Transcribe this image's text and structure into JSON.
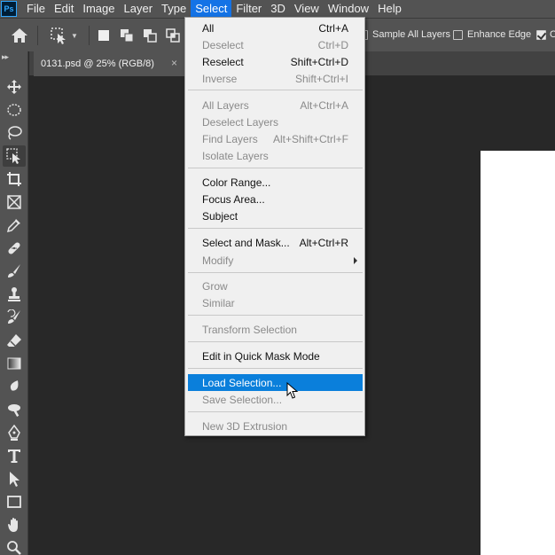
{
  "app": {
    "logo": "Ps"
  },
  "menubar": {
    "items": [
      "File",
      "Edit",
      "Image",
      "Layer",
      "Type",
      "Select",
      "Filter",
      "3D",
      "View",
      "Window",
      "Help"
    ],
    "active": "Select"
  },
  "options": {
    "sample_all_layers": "Sample All Layers",
    "enhance_edge": "Enhance Edge",
    "truncated_label": "O"
  },
  "tab": {
    "title": "0131.psd @ 25% (RGB/8)",
    "close_glyph": "×"
  },
  "select_menu": {
    "items": [
      {
        "label": "All",
        "shortcut": "Ctrl+A",
        "disabled": false
      },
      {
        "label": "Deselect",
        "shortcut": "Ctrl+D",
        "disabled": true
      },
      {
        "label": "Reselect",
        "shortcut": "Shift+Ctrl+D",
        "disabled": false
      },
      {
        "label": "Inverse",
        "shortcut": "Shift+Ctrl+I",
        "disabled": true
      },
      {
        "label": "All Layers",
        "shortcut": "Alt+Ctrl+A",
        "disabled": true
      },
      {
        "label": "Deselect Layers",
        "shortcut": "",
        "disabled": true
      },
      {
        "label": "Find Layers",
        "shortcut": "Alt+Shift+Ctrl+F",
        "disabled": true
      },
      {
        "label": "Isolate Layers",
        "shortcut": "",
        "disabled": true
      },
      {
        "label": "Color Range...",
        "shortcut": "",
        "disabled": false
      },
      {
        "label": "Focus Area...",
        "shortcut": "",
        "disabled": false
      },
      {
        "label": "Subject",
        "shortcut": "",
        "disabled": false
      },
      {
        "label": "Select and Mask...",
        "shortcut": "Alt+Ctrl+R",
        "disabled": false
      },
      {
        "label": "Modify",
        "shortcut": "",
        "disabled": true
      },
      {
        "label": "Grow",
        "shortcut": "",
        "disabled": true
      },
      {
        "label": "Similar",
        "shortcut": "",
        "disabled": true
      },
      {
        "label": "Transform Selection",
        "shortcut": "",
        "disabled": true
      },
      {
        "label": "Edit in Quick Mask Mode",
        "shortcut": "",
        "disabled": false
      },
      {
        "label": "Load Selection...",
        "shortcut": "",
        "disabled": false
      },
      {
        "label": "Save Selection...",
        "shortcut": "",
        "disabled": true
      },
      {
        "label": "New 3D Extrusion",
        "shortcut": "",
        "disabled": true
      }
    ],
    "highlighted": "Load Selection..."
  },
  "colors": {
    "highlight": "#0a7fdb",
    "menu_bg": "#f0f0f0",
    "ui_panel": "#535353",
    "canvas_bg": "#282828"
  }
}
